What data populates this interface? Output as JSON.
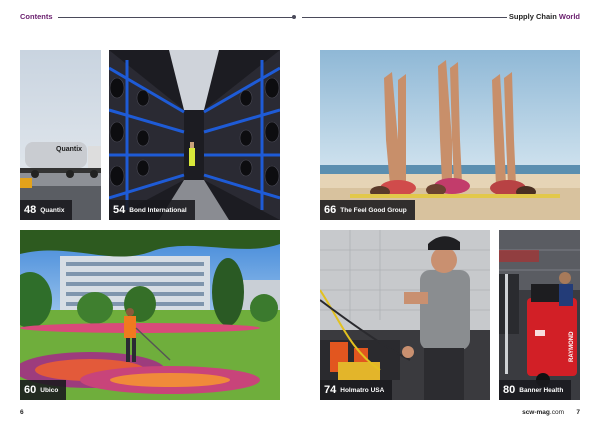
{
  "header": {
    "left_title": "Contents",
    "right_title_prefix": "Supply Chain",
    "right_title_accent": "World"
  },
  "tiles": [
    {
      "num": "48",
      "name": "Quantix",
      "truck_text": "Quantix"
    },
    {
      "num": "54",
      "name": "Bond International"
    },
    {
      "num": "66",
      "name": "The Feel Good Group"
    },
    {
      "num": "60",
      "name": "Ubico"
    },
    {
      "num": "74",
      "name": "Holmatro USA"
    },
    {
      "num": "80",
      "name": "Banner Health",
      "forklift_text": "RAYMOND"
    }
  ],
  "footer": {
    "left_page": "6",
    "site_name": "scw-mag",
    "site_tld": ".com",
    "right_page": "7"
  },
  "colors": {
    "accent": "#6a1f6e",
    "caption_bg": "#19191e"
  }
}
